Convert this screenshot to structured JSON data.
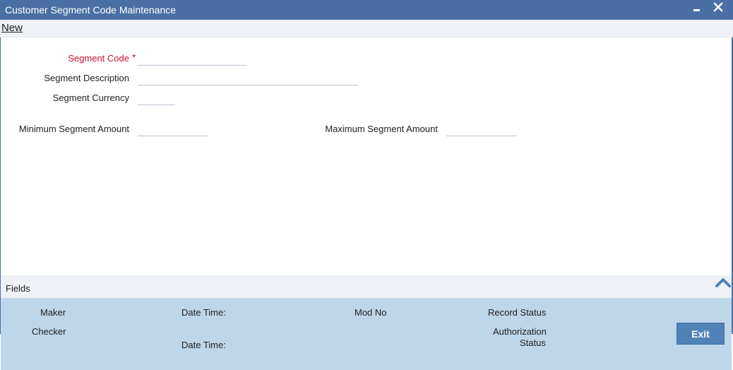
{
  "window": {
    "title": "Customer Segment Code Maintenance",
    "minimize_icon": "minimize-icon",
    "close_icon": "close-icon"
  },
  "toolbar": {
    "new_label": "New"
  },
  "form": {
    "segment_code": {
      "label": "Segment Code",
      "required_mark": "*",
      "value": ""
    },
    "segment_description": {
      "label": "Segment Description",
      "value": ""
    },
    "segment_currency": {
      "label": "Segment Currency",
      "value": ""
    },
    "minimum_segment_amount": {
      "label": "Minimum Segment Amount",
      "value": ""
    },
    "maximum_segment_amount": {
      "label": "Maximum Segment Amount",
      "value": ""
    }
  },
  "fields_bar": {
    "label": "Fields",
    "toggle_icon": "chevron-up-icon"
  },
  "audit": {
    "maker": "Maker",
    "checker": "Checker",
    "date_time_1": "Date Time:",
    "date_time_2": "Date Time:",
    "mod_no": "Mod No",
    "record_status": "Record Status",
    "authorization_line1": "Authorization",
    "authorization_line2": "Status",
    "exit_label": "Exit"
  },
  "colors": {
    "titlebar": "#4a6fa5",
    "required_label": "#c8102e",
    "footer": "#bdd6ea",
    "exit_button": "#4f82b7"
  }
}
